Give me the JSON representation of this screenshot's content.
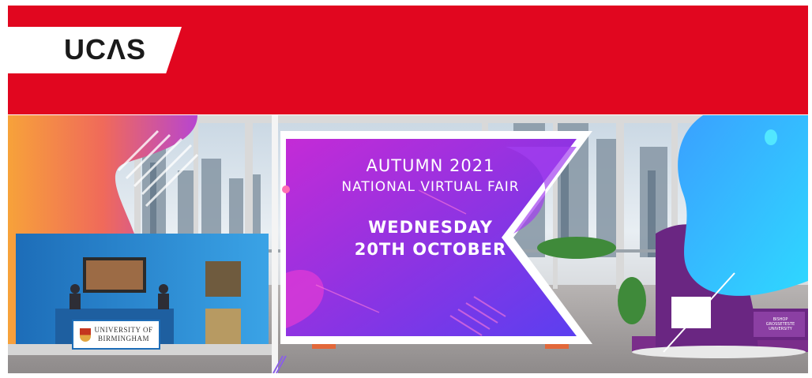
{
  "header": {
    "logo_text": "UCΛS",
    "colors": {
      "brand_red": "#e1061f",
      "logo_bg": "#ffffff"
    }
  },
  "banner": {
    "line1": "AUTUMN 2021",
    "line2": "NATIONAL VIRTUAL FAIR",
    "date_line1": "WEDNESDAY",
    "date_line2": "20TH OCTOBER",
    "colors": {
      "gradient_start": "#c42bd6",
      "gradient_end": "#5b3ff0"
    }
  },
  "booth_left": {
    "sign_line1": "UNIVERSITY OF",
    "sign_line2": "BIRMINGHAM"
  },
  "booth_right": {
    "sign_line1": "BISHOP",
    "sign_line2": "GROSSETESTE",
    "sign_line3": "UNIVERSITY"
  }
}
